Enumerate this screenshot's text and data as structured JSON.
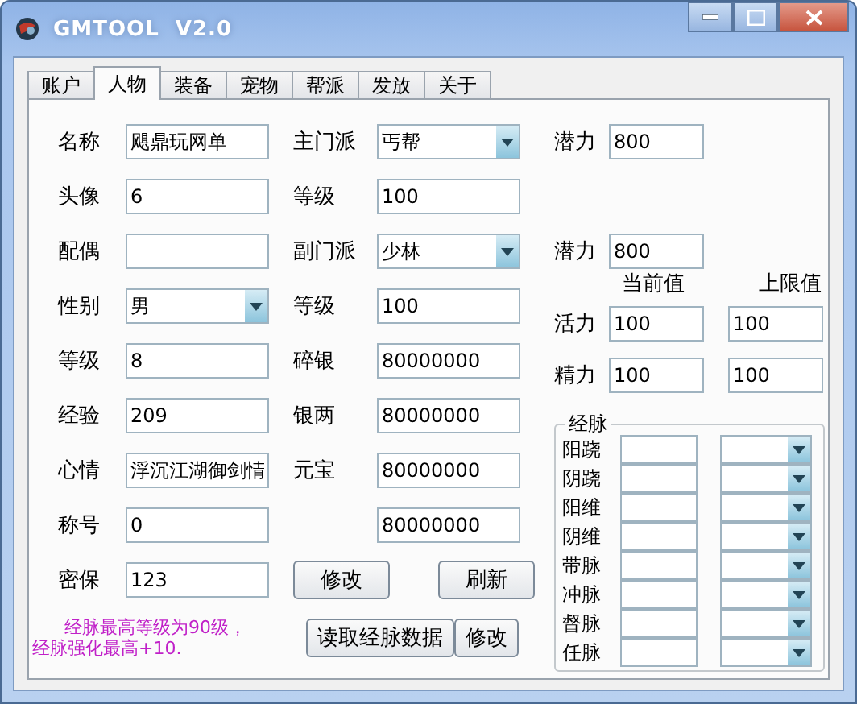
{
  "window": {
    "title": "GMTOOL  V2.0"
  },
  "tabs": [
    {
      "label": "账户",
      "selected": false
    },
    {
      "label": "人物",
      "selected": true
    },
    {
      "label": "装备",
      "selected": false
    },
    {
      "label": "宠物",
      "selected": false
    },
    {
      "label": "帮派",
      "selected": false
    },
    {
      "label": "发放",
      "selected": false
    },
    {
      "label": "关于",
      "selected": false
    }
  ],
  "left_fields": [
    {
      "label": "名称",
      "value": "飓鼎玩网单",
      "kind": "input"
    },
    {
      "label": "头像",
      "value": "6",
      "kind": "input"
    },
    {
      "label": "配偶",
      "kind": "input"
    },
    {
      "label": "性别",
      "value": "男",
      "kind": "combo"
    },
    {
      "label": "等级",
      "value": "8",
      "kind": "input"
    },
    {
      "label": "经验",
      "value": "209",
      "kind": "input"
    },
    {
      "label": "心情",
      "value": "浮沉江湖御剑情",
      "kind": "input"
    },
    {
      "label": "称号",
      "value": "0",
      "kind": "input"
    },
    {
      "label": "密保",
      "value": "123",
      "kind": "input"
    }
  ],
  "middle_fields": [
    {
      "label": "主门派",
      "value": "丐帮",
      "kind": "combo"
    },
    {
      "label": "等级",
      "value": "100",
      "kind": "input"
    },
    {
      "label": "副门派",
      "value": "少林",
      "kind": "combo"
    },
    {
      "label": "等级",
      "value": "100",
      "kind": "input"
    },
    {
      "label": "碎银",
      "value": "80000000",
      "kind": "input"
    },
    {
      "label": "银两",
      "value": "80000000",
      "kind": "input"
    },
    {
      "label": "元宝",
      "value": "80000000",
      "kind": "input"
    },
    {
      "value": "80000000",
      "kind": "input"
    }
  ],
  "middle_buttons": [
    "修改",
    "刷新"
  ],
  "potential": [
    {
      "label": "潜力",
      "value": "800"
    },
    {
      "label": "潜力",
      "value": "800"
    }
  ],
  "stats_headers": [
    "当前值",
    "上限值"
  ],
  "stats": [
    {
      "label": "活力",
      "current": "100",
      "max": "100"
    },
    {
      "label": "精力",
      "current": "100",
      "max": "100"
    }
  ],
  "meridians": {
    "title": "经脉",
    "rows": [
      "阳跷",
      "阴跷",
      "阳维",
      "阴维",
      "带脉",
      "冲脉",
      "督脉",
      "任脉"
    ]
  },
  "note": [
    "经脉最高等级为90级，",
    "经脉强化最高+10."
  ],
  "bottom_buttons": [
    "读取经脉数据",
    "修改"
  ]
}
